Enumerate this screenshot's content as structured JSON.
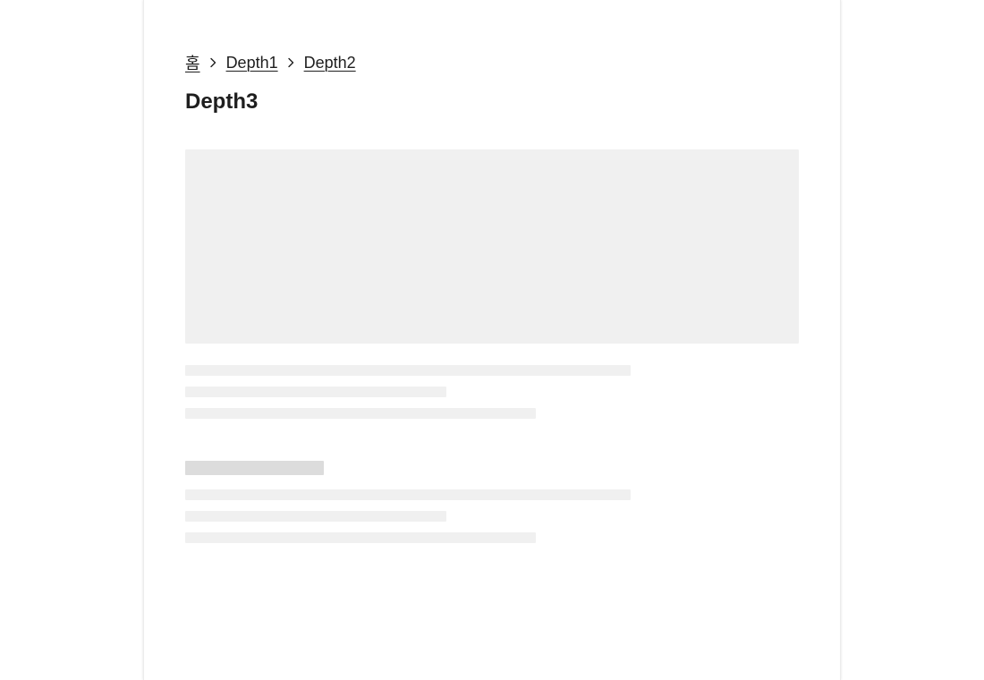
{
  "breadcrumb": {
    "items": [
      {
        "label": "홈"
      },
      {
        "label": "Depth1"
      },
      {
        "label": "Depth2"
      }
    ],
    "separator_icon": "chevron-right-icon"
  },
  "page": {
    "title": "Depth3"
  },
  "colors": {
    "text": "#1e1e1e",
    "skeleton_light": "#f0f0f0",
    "skeleton_dark": "#dcdcdc",
    "background": "#ffffff"
  }
}
